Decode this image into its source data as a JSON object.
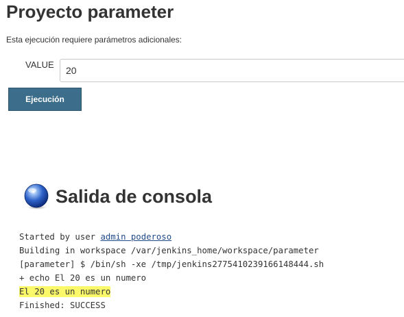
{
  "project": {
    "title": "Proyecto parameter"
  },
  "form": {
    "description": "Esta ejecución requiere parámetros adicionales:",
    "param_label": "VALUE",
    "param_value": "20",
    "build_button_label": "Ejecución"
  },
  "console": {
    "icon": "console-globe-icon",
    "title": "Salida de consola",
    "started_prefix": "Started by user ",
    "started_user": "admin poderoso",
    "lines": [
      "Building in workspace /var/jenkins_home/workspace/parameter",
      "[parameter] $ /bin/sh -xe /tmp/jenkins2775410239166148444.sh",
      "+ echo El 20 es un numero"
    ],
    "highlighted_line": "El 20 es un numero",
    "highlight_color": "#fbf96a",
    "finished_line": "Finished: SUCCESS"
  },
  "colors": {
    "button_bg": "#3c6e8c",
    "link": "#204a87"
  }
}
